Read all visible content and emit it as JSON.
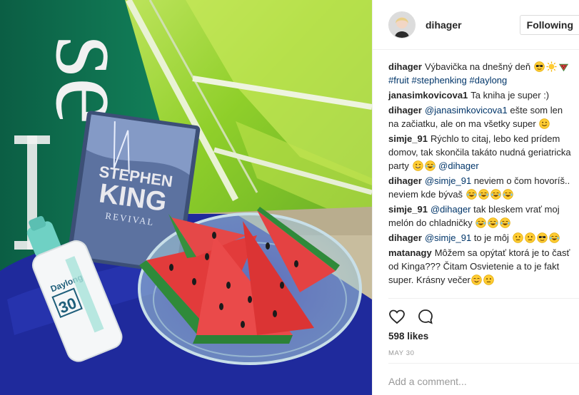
{
  "post": {
    "username": "dihager",
    "follow_label": "Following",
    "likes": "598 likes",
    "date": "MAY 30",
    "add_comment_placeholder": "Add a comment..."
  },
  "photo": {
    "book_author_line1": "STEPHEN",
    "book_author_line2": "KING",
    "book_title": "REVIVAL",
    "sunscreen_brand": "Daylong",
    "sunscreen_spf": "30",
    "banner_letters": "se"
  },
  "comments": [
    {
      "user": "dihager",
      "parts": [
        {
          "type": "text",
          "value": "Výbavička na dnešný deň "
        },
        {
          "type": "emoji",
          "value": "sunglasses"
        },
        {
          "type": "emoji",
          "value": "sun"
        },
        {
          "type": "emoji",
          "value": "watermelon"
        },
        {
          "type": "text",
          "value": " "
        },
        {
          "type": "tag",
          "value": "#fruit"
        },
        {
          "type": "text",
          "value": " "
        },
        {
          "type": "tag",
          "value": "#stephenking"
        },
        {
          "type": "text",
          "value": " "
        },
        {
          "type": "tag",
          "value": "#daylong"
        }
      ]
    },
    {
      "user": "janasimkovicova1",
      "parts": [
        {
          "type": "text",
          "value": "Ta kniha je super :)"
        }
      ]
    },
    {
      "user": "dihager",
      "parts": [
        {
          "type": "mention",
          "value": "@janasimkovicova1"
        },
        {
          "type": "text",
          "value": " ešte som len na začiatku, ale on ma všetky super "
        },
        {
          "type": "emoji",
          "value": "smile"
        }
      ]
    },
    {
      "user": "simje_91",
      "parts": [
        {
          "type": "text",
          "value": "Rýchlo to citaj, lebo ked prídem domov, tak skončila takáto nudná geriatricka party "
        },
        {
          "type": "emoji",
          "value": "wink"
        },
        {
          "type": "emoji",
          "value": "joy"
        },
        {
          "type": "text",
          "value": " "
        },
        {
          "type": "mention",
          "value": "@dihager"
        }
      ]
    },
    {
      "user": "dihager",
      "parts": [
        {
          "type": "mention",
          "value": "@simje_91"
        },
        {
          "type": "text",
          "value": " neviem o čom hovoríš.. neviem kde bývaš "
        },
        {
          "type": "emoji",
          "value": "joy"
        },
        {
          "type": "emoji",
          "value": "joy"
        },
        {
          "type": "emoji",
          "value": "joy"
        },
        {
          "type": "emoji",
          "value": "joy"
        }
      ]
    },
    {
      "user": "simje_91",
      "parts": [
        {
          "type": "mention",
          "value": "@dihager"
        },
        {
          "type": "text",
          "value": " tak bleskem vrať moj melón do chladničky "
        },
        {
          "type": "emoji",
          "value": "joy"
        },
        {
          "type": "emoji",
          "value": "joy"
        },
        {
          "type": "emoji",
          "value": "joy"
        }
      ]
    },
    {
      "user": "dihager",
      "parts": [
        {
          "type": "mention",
          "value": "@simje_91"
        },
        {
          "type": "text",
          "value": " to je môj "
        },
        {
          "type": "emoji",
          "value": "neutral"
        },
        {
          "type": "emoji",
          "value": "neutral"
        },
        {
          "type": "emoji",
          "value": "sunglasses"
        },
        {
          "type": "emoji",
          "value": "joy"
        }
      ]
    },
    {
      "user": "matanagy",
      "parts": [
        {
          "type": "text",
          "value": "Môžem sa opýtať ktorá je to časť od Kinga??? Čitam Osvietenie a to je fakt super. Krásny večer"
        },
        {
          "type": "emoji",
          "value": "blush"
        },
        {
          "type": "emoji",
          "value": "neutral"
        }
      ]
    }
  ],
  "colors": {
    "tag": "#003569",
    "text": "#262626",
    "muted": "#999999",
    "banner_green": "#0f7a55",
    "lime": "#8fcf2a",
    "towel_blue": "#1f2a9c",
    "watermelon_red": "#e23b3b"
  }
}
